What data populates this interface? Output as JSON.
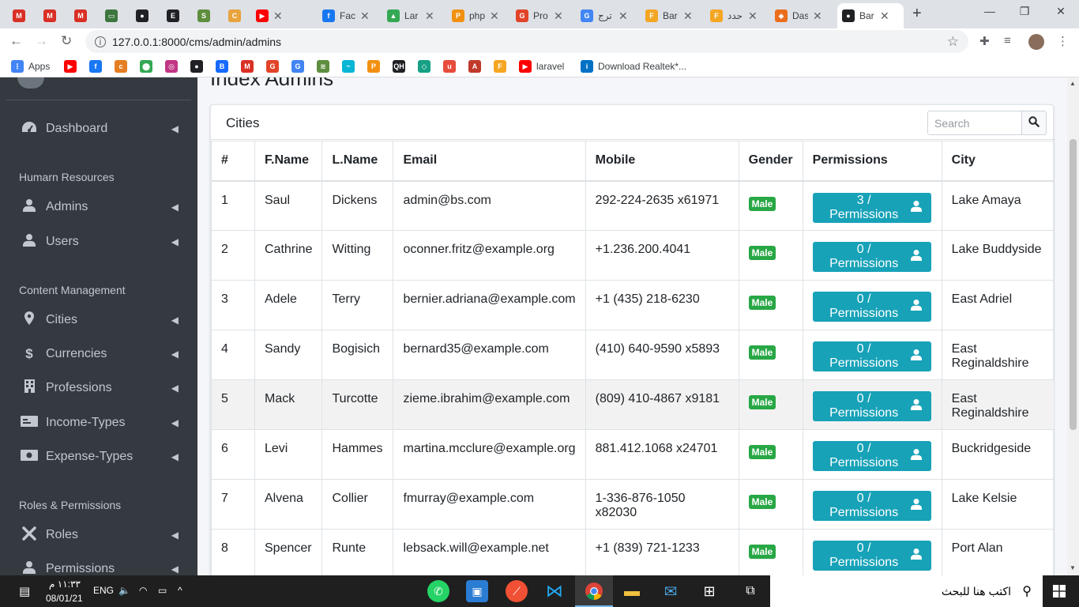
{
  "browser": {
    "tabs": [
      {
        "title": "",
        "icon": "gmail-icon",
        "color": "#d93025",
        "glyph": "M"
      },
      {
        "title": "",
        "icon": "gmail-icon",
        "color": "#d93025",
        "glyph": "M"
      },
      {
        "title": "",
        "icon": "gmail-icon",
        "color": "#d93025",
        "glyph": "M"
      },
      {
        "title": "",
        "icon": "sheet-icon",
        "color": "#3c763d",
        "glyph": "▭"
      },
      {
        "title": "",
        "icon": "github-icon",
        "color": "#202124",
        "glyph": "●"
      },
      {
        "title": "",
        "icon": "e-icon",
        "color": "#202124",
        "glyph": "E"
      },
      {
        "title": "",
        "icon": "shopify-icon",
        "color": "#5e8e3e",
        "glyph": "S"
      },
      {
        "title": "",
        "icon": "circle-icon",
        "color": "#e8a33d",
        "glyph": "C"
      },
      {
        "title": "",
        "icon": "youtube-icon",
        "color": "#ff0000",
        "glyph": "▶"
      },
      {
        "title": "Faci",
        "icon": "facebook-icon",
        "color": "#1877f2",
        "glyph": "f"
      },
      {
        "title": "Lar",
        "icon": "drive-icon",
        "color": "#34a853",
        "glyph": "▲"
      },
      {
        "title": "php",
        "icon": "phpmyadmin-icon",
        "color": "#f29111",
        "glyph": "P"
      },
      {
        "title": "Pro",
        "icon": "gitlab-icon",
        "color": "#e24329",
        "glyph": "G"
      },
      {
        "title": "ترج",
        "icon": "translate-icon",
        "color": "#4285f4",
        "glyph": "G"
      },
      {
        "title": "Bar",
        "icon": "firebase-icon",
        "color": "#f5a623",
        "glyph": "F"
      },
      {
        "title": "حدد",
        "icon": "firebase-icon",
        "color": "#f5a623",
        "glyph": "F"
      },
      {
        "title": "Das",
        "icon": "dashboard-icon",
        "color": "#ea6e1e",
        "glyph": "◆"
      },
      {
        "title": "Bar",
        "icon": "globe-icon",
        "color": "#202124",
        "glyph": "●"
      }
    ],
    "url": "127.0.0.1:8000/cms/admin/admins",
    "bookmarks": [
      {
        "label": "Apps",
        "icon": "apps-grid-icon",
        "color": "#4285f4",
        "glyph": "⋮"
      },
      {
        "label": "",
        "icon": "youtube-icon",
        "color": "#ff0000",
        "glyph": "▶"
      },
      {
        "label": "",
        "icon": "facebook-icon",
        "color": "#1877f2",
        "glyph": "f"
      },
      {
        "label": "",
        "icon": "cis-icon",
        "color": "#e67e22",
        "glyph": "c"
      },
      {
        "label": "",
        "icon": "maps-icon",
        "color": "#34a853",
        "glyph": "⬤"
      },
      {
        "label": "",
        "icon": "instagram-icon",
        "color": "#c13584",
        "glyph": "◎"
      },
      {
        "label": "",
        "icon": "github-icon",
        "color": "#202124",
        "glyph": "●"
      },
      {
        "label": "",
        "icon": "behance-icon",
        "color": "#1769ff",
        "glyph": "B"
      },
      {
        "label": "",
        "icon": "gmail-icon",
        "color": "#d93025",
        "glyph": "M"
      },
      {
        "label": "",
        "icon": "gitlab-icon",
        "color": "#e24329",
        "glyph": "G"
      },
      {
        "label": "",
        "icon": "translate-icon",
        "color": "#4285f4",
        "glyph": "G"
      },
      {
        "label": "",
        "icon": "layers-icon",
        "color": "#5e8e3e",
        "glyph": "≋"
      },
      {
        "label": "",
        "icon": "tailwind-icon",
        "color": "#06b6d4",
        "glyph": "~"
      },
      {
        "label": "",
        "icon": "phpmyadmin-icon",
        "color": "#f29111",
        "glyph": "P"
      },
      {
        "label": "",
        "icon": "qh-icon",
        "color": "#202124",
        "glyph": "QH"
      },
      {
        "label": "",
        "icon": "codepen-icon",
        "color": "#16a085",
        "glyph": "◇"
      },
      {
        "label": "",
        "icon": "u-icon",
        "color": "#e74c3c",
        "glyph": "u"
      },
      {
        "label": "",
        "icon": "arm-icon",
        "color": "#c0392b",
        "glyph": "A"
      },
      {
        "label": "",
        "icon": "firebase-icon",
        "color": "#f5a623",
        "glyph": "F"
      },
      {
        "label": "laravel",
        "icon": "youtube-icon",
        "color": "#ff0000",
        "glyph": "▶"
      },
      {
        "label": "Download Realtek*...",
        "icon": "intel-icon",
        "color": "#0071c5",
        "glyph": "i"
      }
    ]
  },
  "sidebar": {
    "dashboard": "Dashboard",
    "sections": [
      {
        "header": "Humarn Resources",
        "items": [
          {
            "label": "Admins",
            "icon": "user-icon",
            "glyph": "👤"
          },
          {
            "label": "Users",
            "icon": "user-icon",
            "glyph": "👤"
          }
        ]
      },
      {
        "header": "Content Management",
        "items": [
          {
            "label": "Cities",
            "icon": "map-marker-icon",
            "glyph": "⬤"
          },
          {
            "label": "Currencies",
            "icon": "dollar-icon",
            "glyph": "$"
          },
          {
            "label": "Professions",
            "icon": "building-icon",
            "glyph": "▦"
          },
          {
            "label": "Income-Types",
            "icon": "money-bill-icon",
            "glyph": "▭"
          },
          {
            "label": "Expense-Types",
            "icon": "money-bill-icon",
            "glyph": "▭"
          }
        ]
      },
      {
        "header": "Roles & Permissions",
        "items": [
          {
            "label": "Roles",
            "icon": "tools-icon",
            "glyph": "✕"
          },
          {
            "label": "Permissions",
            "icon": "user-icon",
            "glyph": "👤"
          }
        ]
      }
    ]
  },
  "main": {
    "heading": "Index Admins",
    "card_title": "Cities",
    "search_placeholder": "Search",
    "columns": [
      "#",
      "F.Name",
      "L.Name",
      "Email",
      "Mobile",
      "Gender",
      "Permissions",
      "City"
    ],
    "rows": [
      {
        "num": "1",
        "first": "Saul",
        "last": "Dickens",
        "email": "admin@bs.com",
        "mobile": "292-224-2635 x61971",
        "gender": "Male",
        "permissions": "3 / Permissions",
        "city": "Lake Amaya"
      },
      {
        "num": "2",
        "first": "Cathrine",
        "last": "Witting",
        "email": "oconner.fritz@example.org",
        "mobile": "+1.236.200.4041",
        "gender": "Male",
        "permissions": "0 / Permissions",
        "city": "Lake Buddyside"
      },
      {
        "num": "3",
        "first": "Adele",
        "last": "Terry",
        "email": "bernier.adriana@example.com",
        "mobile": "+1 (435) 218-6230",
        "gender": "Male",
        "permissions": "0 / Permissions",
        "city": "East Adriel"
      },
      {
        "num": "4",
        "first": "Sandy",
        "last": "Bogisich",
        "email": "bernard35@example.com",
        "mobile": "(410) 640-9590 x5893",
        "gender": "Male",
        "permissions": "0 / Permissions",
        "city": "East Reginaldshire"
      },
      {
        "num": "5",
        "first": "Mack",
        "last": "Turcotte",
        "email": "zieme.ibrahim@example.com",
        "mobile": "(809) 410-4867 x9181",
        "gender": "Male",
        "permissions": "0 / Permissions",
        "city": "East Reginaldshire"
      },
      {
        "num": "6",
        "first": "Levi",
        "last": "Hammes",
        "email": "martina.mcclure@example.org",
        "mobile": "881.412.1068 x24701",
        "gender": "Male",
        "permissions": "0 / Permissions",
        "city": "Buckridgeside"
      },
      {
        "num": "7",
        "first": "Alvena",
        "last": "Collier",
        "email": "fmurray@example.com",
        "mobile": "1-336-876-1050 x82030",
        "gender": "Male",
        "permissions": "0 / Permissions",
        "city": "Lake Kelsie"
      },
      {
        "num": "8",
        "first": "Spencer",
        "last": "Runte",
        "email": "lebsack.will@example.net",
        "mobile": "+1 (839) 721-1233",
        "gender": "Male",
        "permissions": "0 / Permissions",
        "city": "Port Alan"
      }
    ]
  },
  "taskbar": {
    "search_text": "اكتب هنا للبحث",
    "language": "ENG",
    "time": "١١:٣٣ م",
    "date": "08/01/21"
  },
  "colors": {
    "sidebar_bg": "#343a40",
    "badge_green": "#28a745",
    "button_info": "#17a2b8"
  }
}
